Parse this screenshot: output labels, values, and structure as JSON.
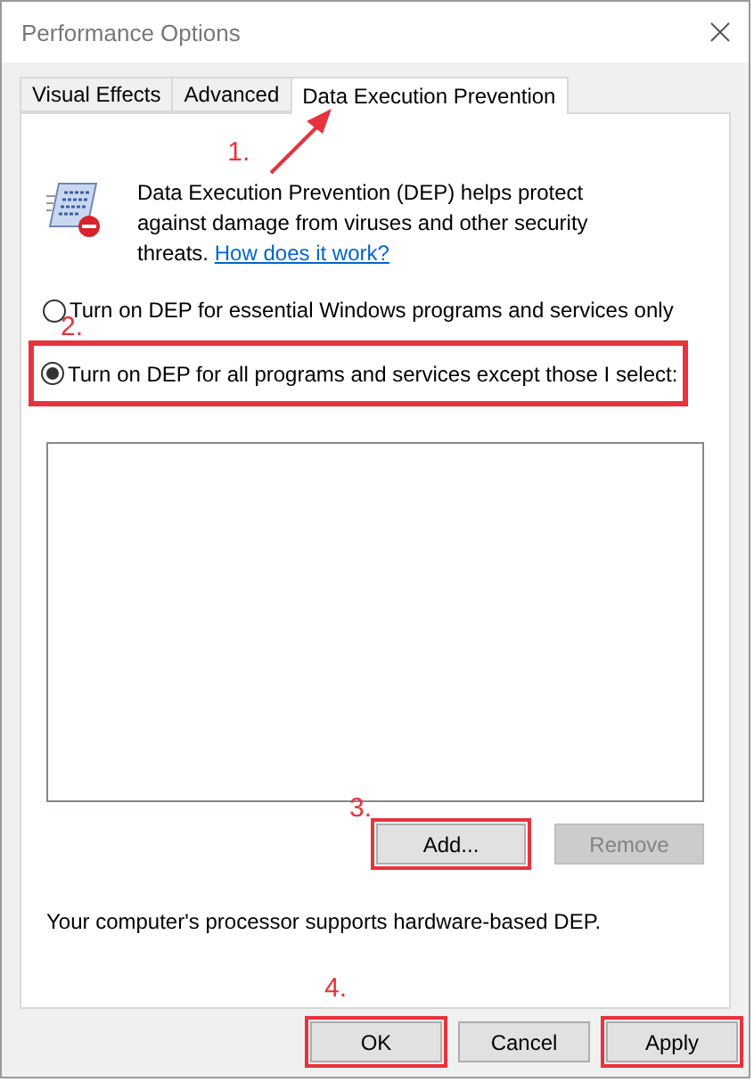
{
  "window": {
    "title": "Performance Options"
  },
  "tabs": [
    {
      "label": "Visual Effects",
      "selected": false
    },
    {
      "label": "Advanced",
      "selected": false
    },
    {
      "label": "Data Execution Prevention",
      "selected": true,
      "step": "1."
    }
  ],
  "intro": {
    "text": "Data Execution Prevention (DEP) helps protect against damage from viruses and other security threats.",
    "link": "How does it work?"
  },
  "options": [
    {
      "label": "Turn on DEP for essential Windows programs and services only",
      "selected": false,
      "highlighted": false
    },
    {
      "label": "Turn on DEP for all programs and services except those I select:",
      "selected": true,
      "highlighted": true,
      "step": "2."
    }
  ],
  "list_buttons": [
    {
      "label": "Add...",
      "disabled": false,
      "highlighted": true,
      "step": "3."
    },
    {
      "label": "Remove",
      "disabled": true,
      "highlighted": false
    }
  ],
  "info": "Your computer's processor supports hardware-based DEP.",
  "dialog_buttons": [
    {
      "label": "OK",
      "highlighted": true,
      "step": "4."
    },
    {
      "label": "Cancel",
      "highlighted": false
    },
    {
      "label": "Apply",
      "highlighted": true
    }
  ]
}
